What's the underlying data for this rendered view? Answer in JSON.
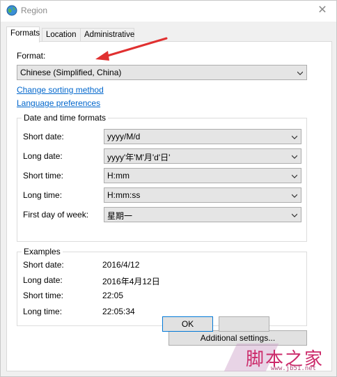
{
  "window": {
    "title": "Region",
    "close_glyph": "✕"
  },
  "tabs": [
    {
      "label": "Formats",
      "active": true
    },
    {
      "label": "Location",
      "active": false
    },
    {
      "label": "Administrative",
      "active": false
    }
  ],
  "formats": {
    "format_label": "Format:",
    "format_value": "Chinese (Simplified, China)",
    "link_sorting": "Change sorting method",
    "link_language": "Language preferences",
    "date_time_group": {
      "title": "Date and time formats",
      "rows": [
        {
          "label": "Short date:",
          "value": "yyyy/M/d"
        },
        {
          "label": "Long date:",
          "value": "yyyy'年'M'月'd'日'"
        },
        {
          "label": "Short time:",
          "value": "H:mm"
        },
        {
          "label": "Long time:",
          "value": "H:mm:ss"
        },
        {
          "label": "First day of week:",
          "value": "星期一"
        }
      ]
    },
    "examples_group": {
      "title": "Examples",
      "rows": [
        {
          "label": "Short date:",
          "value": "2016/4/12"
        },
        {
          "label": "Long date:",
          "value": "2016年4月12日"
        },
        {
          "label": "Short time:",
          "value": "22:05"
        },
        {
          "label": "Long time:",
          "value": "22:05:34"
        }
      ]
    },
    "additional_settings_label": "Additional settings..."
  },
  "footer": {
    "ok_label": "OK"
  },
  "watermark": {
    "text": "脚本之家",
    "url": "www.jb51.net"
  },
  "colors": {
    "link": "#0066cc",
    "annotation_arrow": "#e03030",
    "watermark": "#cc2a6a"
  },
  "icons": [
    "globe-icon",
    "close-icon",
    "chevron-down-icon",
    "red-arrow-annotation"
  ]
}
